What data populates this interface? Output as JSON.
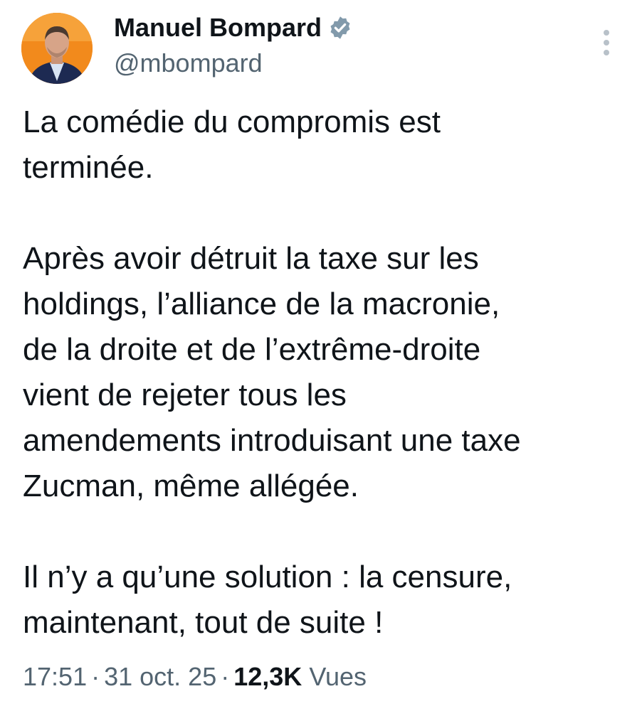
{
  "tweet": {
    "author": {
      "name": "Manuel Bompard",
      "handle": "@mbompard",
      "verified": true,
      "avatar_icon": "profile-photo"
    },
    "paragraphs": [
      "La comédie du compromis est\nterminée.",
      "Après avoir détruit la taxe sur les\nholdings, l’alliance de la macronie,\nde la droite et de l’extrême-droite\nvient de rejeter tous les\namendements introduisant une taxe\nZucman, même allégée.",
      "Il n’y a qu’une solution : la censure,\nmaintenant, tout de suite !"
    ],
    "meta": {
      "time": "17:51",
      "separator": "·",
      "date": "31 oct. 25",
      "views_count": "12,3K",
      "views_label": "Vues"
    }
  },
  "colors": {
    "text_primary": "#0f1419",
    "text_secondary": "#536471",
    "verified_badge": "#829aab",
    "avatar_background": "#f28a1c"
  },
  "icons": {
    "verified": "verified-badge-icon",
    "more": "more-vertical-icon"
  }
}
